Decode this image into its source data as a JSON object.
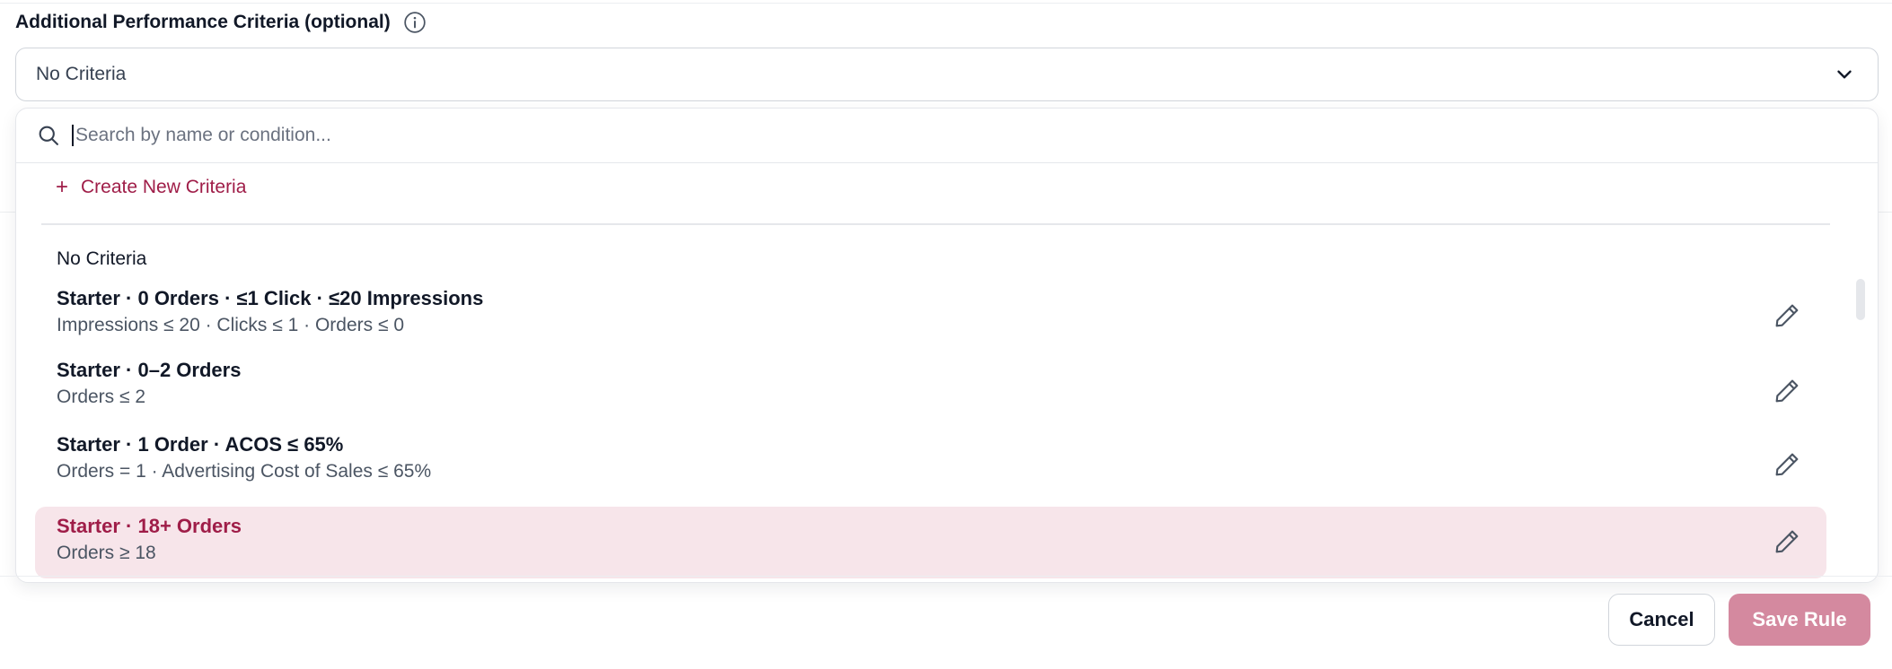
{
  "field": {
    "label": "Additional Performance Criteria (optional)",
    "info_icon": "info-icon"
  },
  "select": {
    "value": "No Criteria",
    "chevron_icon": "chevron-down-icon"
  },
  "dropdown": {
    "search": {
      "placeholder": "Search by name or condition...",
      "value": "",
      "icon": "search-icon"
    },
    "create_label": "Create New Criteria",
    "plain_option": "No Criteria",
    "options": [
      {
        "title": "Starter · 0 Orders · ≤1 Click · ≤20 Impressions",
        "subtitle": "Impressions ≤ 20 · Clicks ≤ 1 · Orders ≤ 0"
      },
      {
        "title": "Starter · 0–2 Orders",
        "subtitle": "Orders ≤ 2"
      },
      {
        "title": "Starter · 1 Order · ACOS ≤ 65%",
        "subtitle": "Orders = 1 · Advertising Cost of Sales ≤ 65%"
      },
      {
        "title": "Starter · 18+ Orders",
        "subtitle": "Orders ≥ 18",
        "highlighted": true
      }
    ]
  },
  "footer": {
    "cancel_label": "Cancel",
    "save_label": "Save Rule"
  },
  "colors": {
    "accent": "#9f1d48",
    "highlight_bg": "#f7e5ea",
    "save_button_disabled": "#d4899f"
  }
}
